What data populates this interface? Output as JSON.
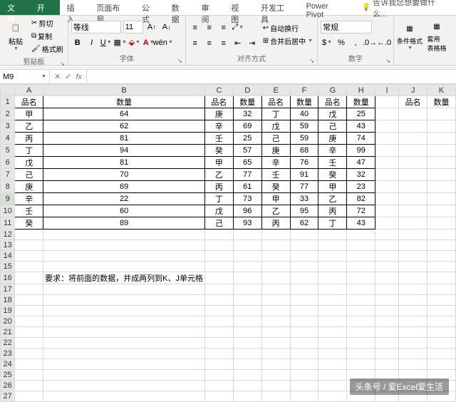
{
  "tabs": {
    "file": "文件",
    "home": "开始",
    "insert": "插入",
    "layout": "页面布局",
    "formula": "公式",
    "data": "数据",
    "review": "审阅",
    "view": "视图",
    "dev": "开发工具",
    "pivot": "Power Pivot",
    "tell": "告诉我您想要做什么..."
  },
  "ribbon": {
    "clipboard": {
      "label": "剪贴板",
      "paste": "粘贴",
      "cut": "剪切",
      "copy": "复制",
      "painter": "格式刷"
    },
    "font": {
      "label": "字体",
      "name": "等线",
      "size": "11"
    },
    "align": {
      "label": "对齐方式",
      "wrap": "自动换行",
      "merge": "合并后居中"
    },
    "number": {
      "label": "数字",
      "format": "常规"
    },
    "style": {
      "cond": "条件格式",
      "table": "套用\n表格格"
    }
  },
  "namebox": "M9",
  "columns": [
    "A",
    "B",
    "C",
    "D",
    "E",
    "F",
    "G",
    "H",
    "I",
    "J",
    "K"
  ],
  "rows": 27,
  "selection": {
    "row": 9,
    "col": "M"
  },
  "headers": [
    "品名",
    "数量",
    "品名",
    "数量",
    "品名",
    "数量",
    "品名",
    "数量"
  ],
  "headersJK": [
    "品名",
    "数量"
  ],
  "data": [
    [
      "甲",
      64,
      "庚",
      32,
      "丁",
      40,
      "戊",
      25
    ],
    [
      "乙",
      62,
      "辛",
      69,
      "戊",
      59,
      "己",
      43
    ],
    [
      "丙",
      81,
      "壬",
      25,
      "己",
      59,
      "庚",
      74
    ],
    [
      "丁",
      94,
      "癸",
      57,
      "庚",
      68,
      "辛",
      99
    ],
    [
      "戊",
      81,
      "甲",
      65,
      "辛",
      76,
      "壬",
      47
    ],
    [
      "己",
      70,
      "乙",
      77,
      "壬",
      91,
      "癸",
      32
    ],
    [
      "庚",
      69,
      "丙",
      61,
      "癸",
      77,
      "甲",
      23
    ],
    [
      "辛",
      22,
      "丁",
      73,
      "甲",
      33,
      "乙",
      82
    ],
    [
      "壬",
      60,
      "戊",
      96,
      "乙",
      95,
      "丙",
      72
    ],
    [
      "癸",
      89,
      "己",
      93,
      "丙",
      62,
      "丁",
      43
    ]
  ],
  "note": "要求：将前面的数据，并成两列到K、J单元格",
  "note_row": 16,
  "watermark": "头条号 / 爱Excel爱生活",
  "chart_data": {
    "type": "table",
    "title": "",
    "columns": [
      "品名",
      "数量",
      "品名",
      "数量",
      "品名",
      "数量",
      "品名",
      "数量"
    ],
    "rows": [
      [
        "甲",
        64,
        "庚",
        32,
        "丁",
        40,
        "戊",
        25
      ],
      [
        "乙",
        62,
        "辛",
        69,
        "戊",
        59,
        "己",
        43
      ],
      [
        "丙",
        81,
        "壬",
        25,
        "己",
        59,
        "庚",
        74
      ],
      [
        "丁",
        94,
        "癸",
        57,
        "庚",
        68,
        "辛",
        99
      ],
      [
        "戊",
        81,
        "甲",
        65,
        "辛",
        76,
        "壬",
        47
      ],
      [
        "己",
        70,
        "乙",
        77,
        "壬",
        91,
        "癸",
        32
      ],
      [
        "庚",
        69,
        "丙",
        61,
        "癸",
        77,
        "甲",
        23
      ],
      [
        "辛",
        22,
        "丁",
        73,
        "甲",
        33,
        "乙",
        82
      ],
      [
        "壬",
        60,
        "戊",
        96,
        "乙",
        95,
        "丙",
        72
      ],
      [
        "癸",
        89,
        "己",
        93,
        "丙",
        62,
        "丁",
        43
      ]
    ]
  }
}
